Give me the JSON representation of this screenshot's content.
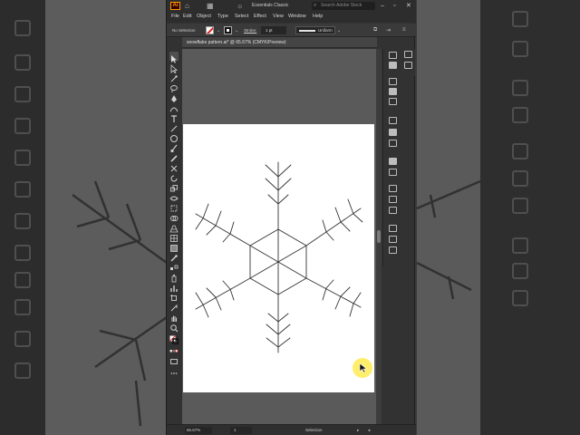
{
  "app": {
    "logo": "Ai",
    "workspace": "Essentials Classic",
    "stock_search_placeholder": "Search Adobe Stock",
    "icons": [
      "home-icon",
      "arrange-documents-icon",
      "lightbulb-icon",
      "search-icon",
      "minimize-icon",
      "maximize-icon",
      "close-icon"
    ]
  },
  "menu": [
    "File",
    "Edit",
    "Object",
    "Type",
    "Select",
    "Effect",
    "View",
    "Window",
    "Help"
  ],
  "control_bar": {
    "selection_status": "No Selection",
    "stroke_label": "Stroke:",
    "stroke_weight": "1 pt",
    "profile": "Uniform"
  },
  "document": {
    "tab_title": "snowflake pattern.ai* @ 65.67% (CMYK/Preview)",
    "close_glyph": "×"
  },
  "status": {
    "zoom": "65.67%",
    "page": "1",
    "tool": "Selection"
  },
  "colors": {
    "accent": "#ff9a00",
    "artboard": "#ffffff",
    "pasteboard": "#5a5a5a",
    "cursor_highlight": "#ffeb50"
  }
}
